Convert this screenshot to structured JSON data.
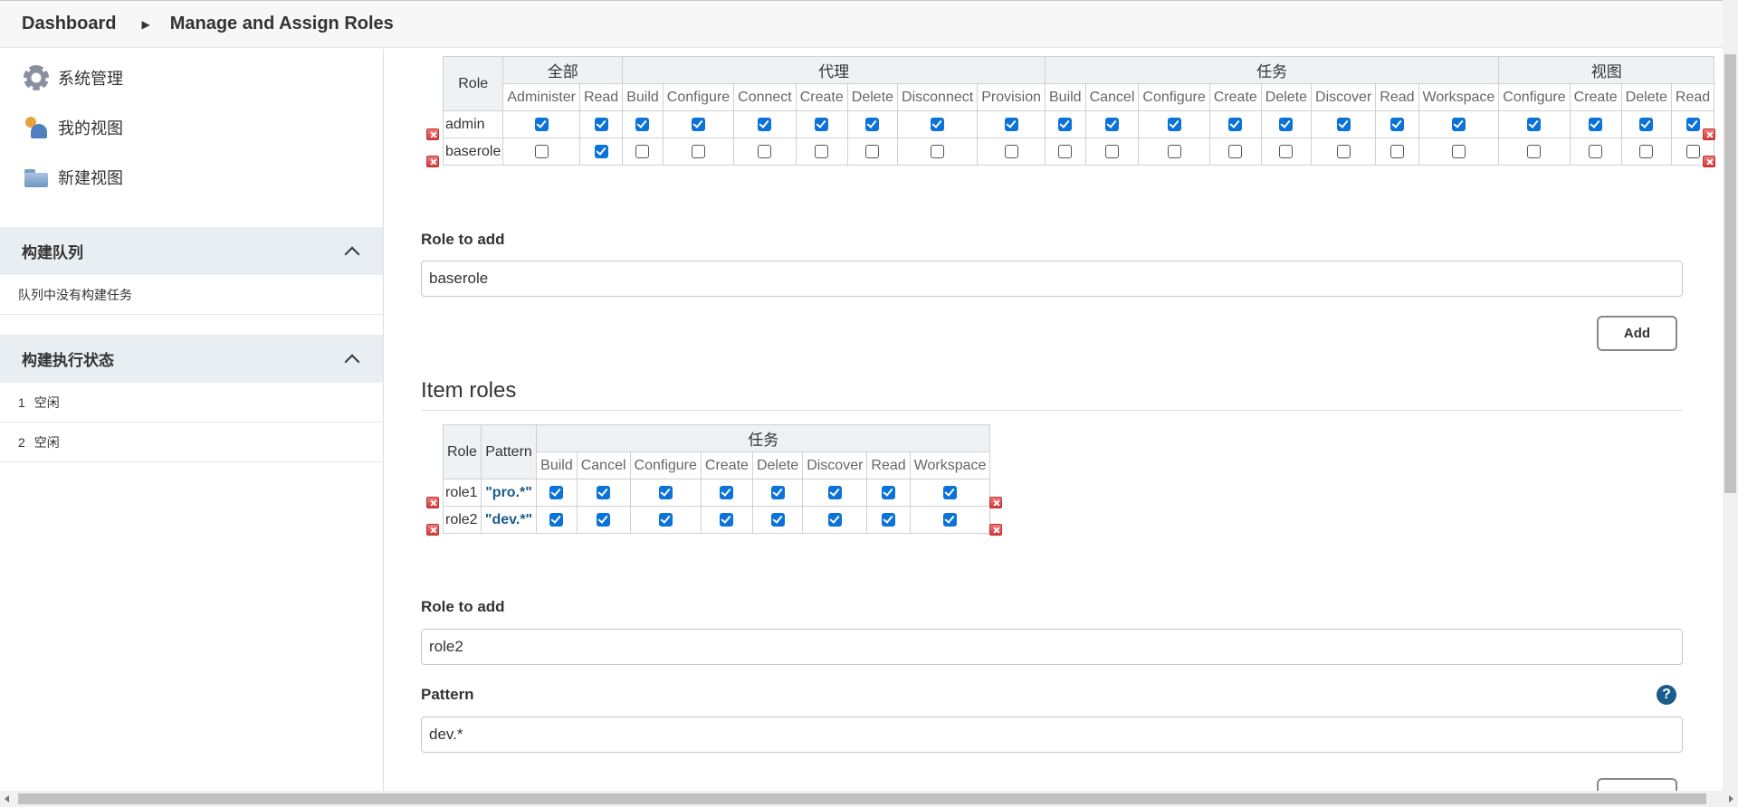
{
  "breadcrumb": {
    "home": "Dashboard",
    "current": "Manage and Assign Roles"
  },
  "sidebar": {
    "tasks": [
      {
        "label": "系统管理",
        "icon": "gear-icon"
      },
      {
        "label": "我的视图",
        "icon": "people-icon"
      },
      {
        "label": "新建视图",
        "icon": "folder-icon"
      }
    ],
    "queue": {
      "title": "构建队列",
      "empty": "队列中没有构建任务"
    },
    "executors": {
      "title": "构建执行状态",
      "rows": [
        {
          "num": "1",
          "status": "空闲"
        },
        {
          "num": "2",
          "status": "空闲"
        }
      ]
    }
  },
  "global_roles": {
    "role_header": "Role",
    "groups": [
      {
        "label": "全部",
        "perms": [
          "Administer",
          "Read"
        ]
      },
      {
        "label": "代理",
        "perms": [
          "Build",
          "Configure",
          "Connect",
          "Create",
          "Delete",
          "Disconnect",
          "Provision"
        ]
      },
      {
        "label": "任务",
        "perms": [
          "Build",
          "Cancel",
          "Configure",
          "Create",
          "Delete",
          "Discover",
          "Read",
          "Workspace"
        ]
      },
      {
        "label": "视图",
        "perms": [
          "Configure",
          "Create",
          "Delete",
          "Read"
        ]
      }
    ],
    "rows": [
      {
        "name": "admin",
        "checks": [
          1,
          1,
          1,
          1,
          1,
          1,
          1,
          1,
          1,
          1,
          1,
          1,
          1,
          1,
          1,
          1,
          1,
          1,
          1,
          1,
          1
        ]
      },
      {
        "name": "baserole",
        "checks": [
          0,
          1,
          0,
          0,
          0,
          0,
          0,
          0,
          0,
          0,
          0,
          0,
          0,
          0,
          0,
          0,
          0,
          0,
          0,
          0,
          0
        ]
      }
    ],
    "role_to_add_label": "Role to add",
    "role_to_add_value": "baserole",
    "add_button": "Add"
  },
  "item_roles": {
    "title": "Item roles",
    "role_header": "Role",
    "pattern_header": "Pattern",
    "group": "任务",
    "perms": [
      "Build",
      "Cancel",
      "Configure",
      "Create",
      "Delete",
      "Discover",
      "Read",
      "Workspace"
    ],
    "rows": [
      {
        "name": "role1",
        "pattern": "\"pro.*\"",
        "checks": [
          1,
          1,
          1,
          1,
          1,
          1,
          1,
          1
        ]
      },
      {
        "name": "role2",
        "pattern": "\"dev.*\"",
        "checks": [
          1,
          1,
          1,
          1,
          1,
          1,
          1,
          1
        ]
      }
    ],
    "role_to_add_label": "Role to add",
    "role_to_add_value": "role2",
    "pattern_label": "Pattern",
    "pattern_value": "dev.*",
    "help": "?"
  }
}
